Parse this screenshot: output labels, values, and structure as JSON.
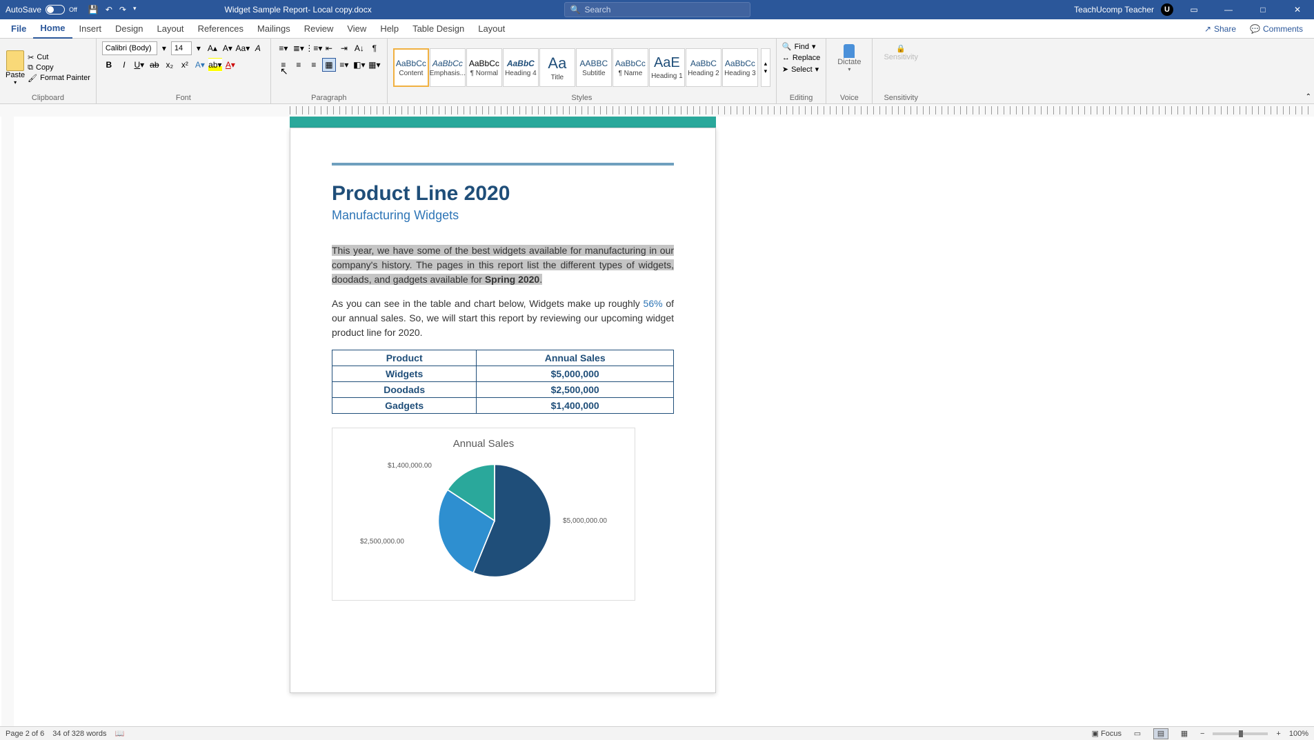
{
  "titlebar": {
    "autosave_label": "AutoSave",
    "autosave_state": "Off",
    "doc_title": "Widget Sample Report- Local copy.docx",
    "search_placeholder": "Search",
    "user": "TeachUcomp Teacher",
    "avatar_initial": "U"
  },
  "tabs": {
    "file": "File",
    "home": "Home",
    "insert": "Insert",
    "design": "Design",
    "layout": "Layout",
    "references": "References",
    "mailings": "Mailings",
    "review": "Review",
    "view": "View",
    "help": "Help",
    "table_design": "Table Design",
    "table_layout": "Layout",
    "share": "Share",
    "comments": "Comments"
  },
  "ribbon": {
    "clipboard": {
      "paste": "Paste",
      "cut": "Cut",
      "copy": "Copy",
      "format_painter": "Format Painter",
      "label": "Clipboard"
    },
    "font": {
      "name": "Calibri (Body)",
      "size": "14",
      "label": "Font"
    },
    "paragraph": {
      "label": "Paragraph"
    },
    "styles_items": [
      {
        "sample": "AaBbCc",
        "label": "Content",
        "cls": ""
      },
      {
        "sample": "AaBbCc",
        "label": "Emphasis...",
        "cls": "em"
      },
      {
        "sample": "AaBbCc",
        "label": "¶ Normal",
        "cls": "norm"
      },
      {
        "sample": "AaBbC",
        "label": "Heading 4",
        "cls": "h4"
      },
      {
        "sample": "Aa",
        "label": "Title",
        "cls": "title"
      },
      {
        "sample": "AABBC",
        "label": "Subtitle",
        "cls": "sub"
      },
      {
        "sample": "AaBbCc",
        "label": "¶ Name",
        "cls": "name"
      },
      {
        "sample": "AaE",
        "label": "Heading 1",
        "cls": "h1"
      },
      {
        "sample": "AaBbC",
        "label": "Heading 2",
        "cls": "h2"
      },
      {
        "sample": "AaBbCc",
        "label": "Heading 3",
        "cls": "h3"
      }
    ],
    "styles_label": "Styles",
    "editing": {
      "find": "Find",
      "replace": "Replace",
      "select": "Select",
      "label": "Editing"
    },
    "dictate": "Dictate",
    "voice_label": "Voice",
    "sensitivity": "Sensitivity",
    "sens_label": "Sensitivity"
  },
  "document": {
    "h1": "Product Line 2020",
    "h2": "Manufacturing Widgets",
    "p1_a": "This year, we have some of the best widgets available for manufacturing in our company's history. The pages in this report list the different types of widgets, doodads, and gadgets available for ",
    "p1_b": "Spring 2020",
    "p1_c": ".",
    "p2_a": "As you can see in the table and chart below, Widgets make up roughly ",
    "p2_link": "56%",
    "p2_b": " of our annual sales. So, we will start this report by reviewing our upcoming widget product line for 2020.",
    "table": {
      "headers": [
        "Product",
        "Annual Sales"
      ],
      "rows": [
        [
          "Widgets",
          "$5,000,000"
        ],
        [
          "Doodads",
          "$2,500,000"
        ],
        [
          "Gadgets",
          "$1,400,000"
        ]
      ]
    },
    "chart_title": "Annual Sales",
    "chart_labels": {
      "a": "$5,000,000.00",
      "b": "$2,500,000.00",
      "c": "$1,400,000.00"
    }
  },
  "chart_data": {
    "type": "pie",
    "title": "Annual Sales",
    "categories": [
      "Widgets",
      "Doodads",
      "Gadgets"
    ],
    "values": [
      5000000,
      2500000,
      1400000
    ],
    "colors": [
      "#1f4e79",
      "#2e8fd0",
      "#2aa89b"
    ]
  },
  "statusbar": {
    "page": "Page 2 of 6",
    "words": "34 of 328 words",
    "focus": "Focus",
    "zoom": "100%"
  }
}
